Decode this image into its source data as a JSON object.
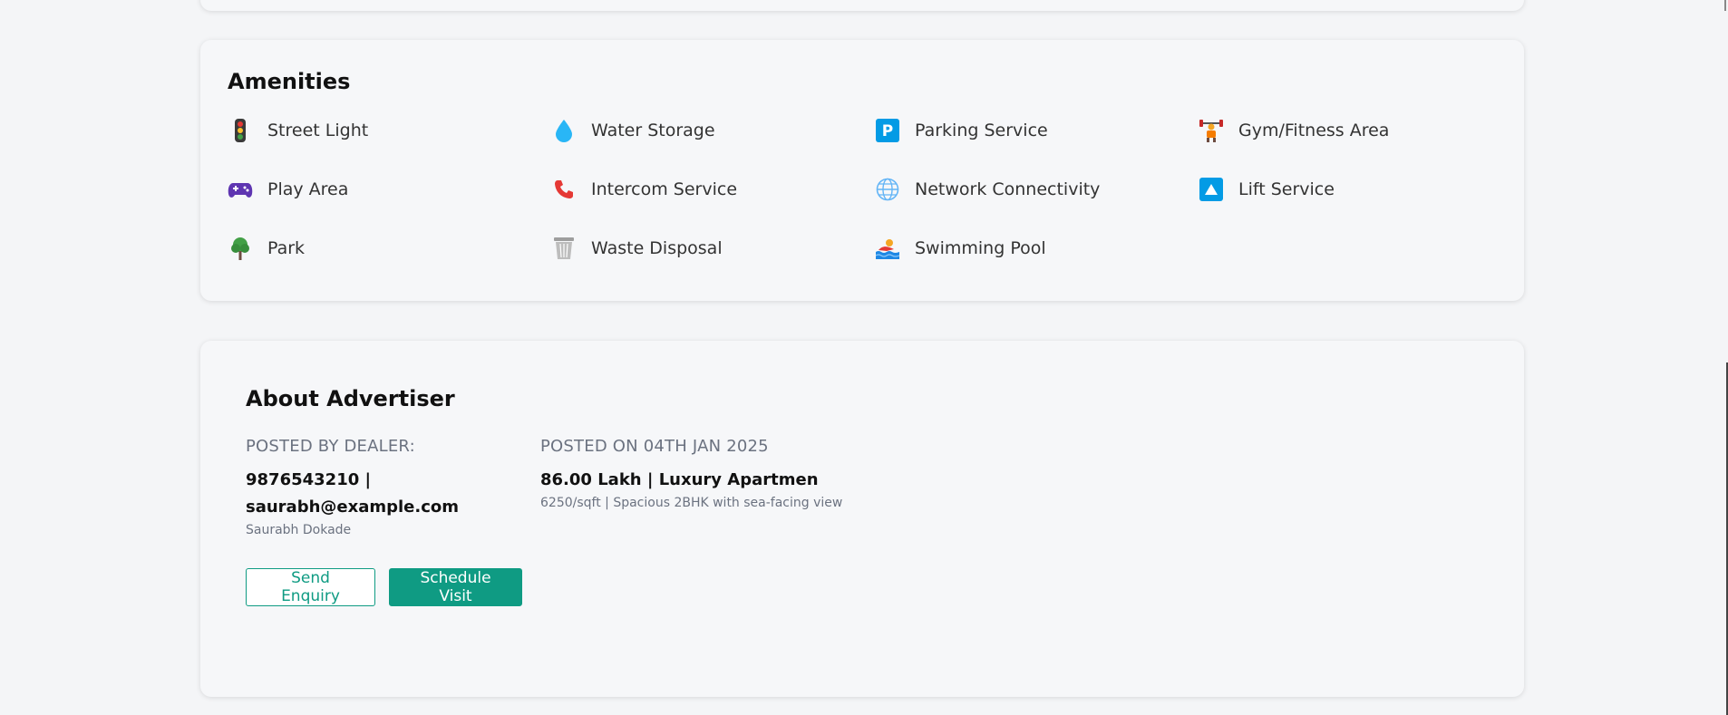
{
  "amenities": {
    "title": "Amenities",
    "items": [
      {
        "label": "Street Light",
        "icon": "traffic-light-icon"
      },
      {
        "label": "Water Storage",
        "icon": "water-drop-icon"
      },
      {
        "label": "Parking Service",
        "icon": "parking-icon"
      },
      {
        "label": "Gym/Fitness Area",
        "icon": "weightlifter-icon"
      },
      {
        "label": "Play Area",
        "icon": "game-controller-icon"
      },
      {
        "label": "Intercom Service",
        "icon": "telephone-icon"
      },
      {
        "label": "Network Connectivity",
        "icon": "globe-icon"
      },
      {
        "label": "Lift Service",
        "icon": "up-arrow-icon"
      },
      {
        "label": "Park",
        "icon": "tree-icon"
      },
      {
        "label": "Waste Disposal",
        "icon": "wastebasket-icon"
      },
      {
        "label": "Swimming Pool",
        "icon": "swimmer-icon"
      }
    ]
  },
  "about": {
    "title": "About Advertiser",
    "dealer_label": "POSTED BY DEALER:",
    "dealer_contact_line1": "9876543210 |",
    "dealer_contact_line2": "saurabh@example.com",
    "dealer_name": "Saurabh Dokade",
    "posted_label": "POSTED ON 04TH JAN 2025",
    "price_line": "86.00 Lakh | Luxury Apartmen",
    "price_sub": "6250/sqft | Spacious 2BHK with sea-facing view",
    "enquiry_button": "Send Enquiry",
    "visit_button": "Schedule Visit"
  },
  "colors": {
    "accent": "#0f9b83",
    "background": "#f4f5f7",
    "muted": "#6b7280"
  }
}
